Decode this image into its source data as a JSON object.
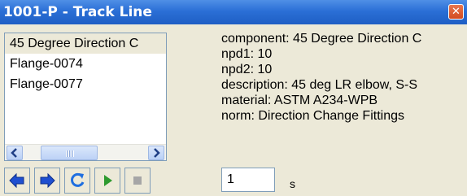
{
  "window": {
    "title": "1001-P - Track Line",
    "close_glyph": "✕"
  },
  "list": {
    "items": [
      {
        "label": "45 Degree Direction C"
      },
      {
        "label": "Flange-0074"
      },
      {
        "label": "Flange-0077"
      }
    ],
    "scroll_left_icon": "chevron-left-icon",
    "scroll_right_icon": "chevron-right-icon"
  },
  "details": {
    "lines": [
      "component: 45 Degree Direction C",
      "npd1: 10",
      "npd2: 10",
      "description: 45 deg LR elbow, S-S",
      "material: ASTM A234-WPB",
      "norm: Direction Change Fittings"
    ]
  },
  "toolbar": {
    "buttons": [
      {
        "icon": "step-back-icon"
      },
      {
        "icon": "step-forward-icon"
      },
      {
        "icon": "refresh-icon"
      },
      {
        "icon": "play-icon"
      },
      {
        "icon": "stop-icon"
      }
    ],
    "interval_value": "1",
    "interval_unit": "s"
  },
  "colors": {
    "titlebar": "#2b6fd6",
    "close": "#d24a20",
    "play": "#2e9a2e",
    "arrow": "#1f4fd0"
  }
}
